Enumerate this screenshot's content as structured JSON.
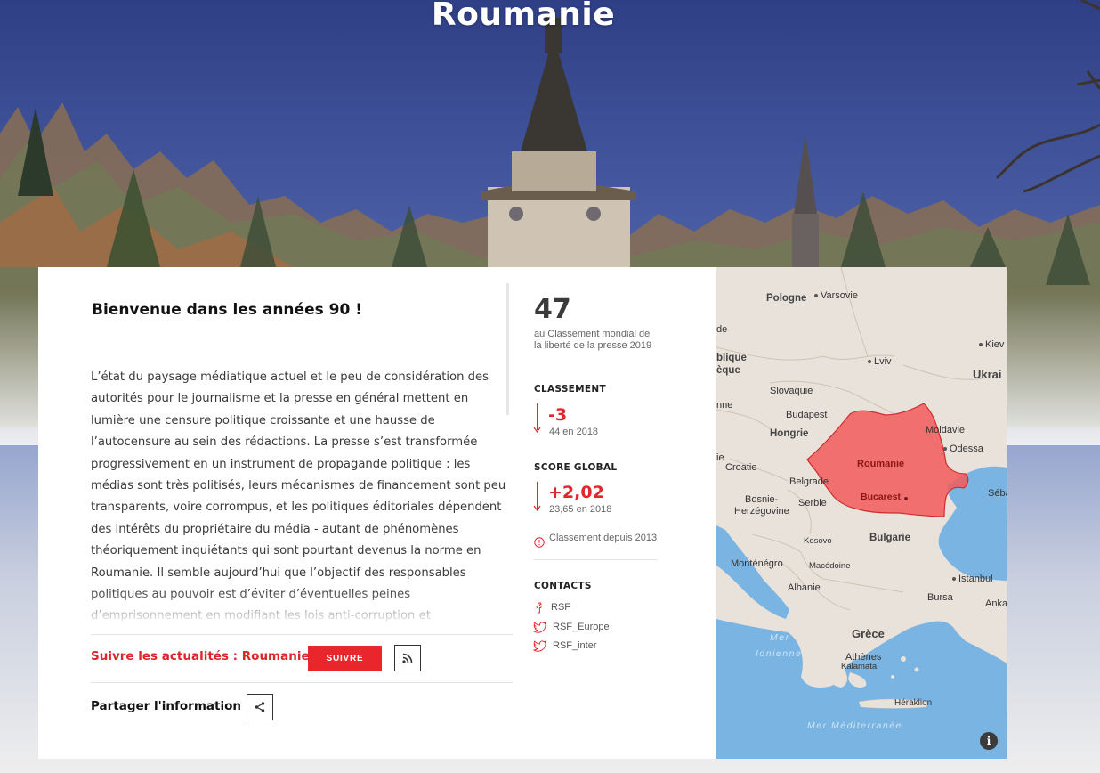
{
  "page": {
    "title": "Roumanie"
  },
  "article": {
    "title": "Bienvenue dans les années 90 !",
    "body": "L’état du paysage médiatique actuel et le peu de considération des autorités pour le journalisme et la presse en général mettent en lumière une censure politique croissante et une hausse de l’autocensure au sein des rédactions. La presse s’est transformée progressivement en un instrument de propagande politique : les médias sont très politisés, leurs mécanismes de financement sont peu transparents, voire corrompus, et les politiques éditoriales dépendent des intérêts du propriétaire du média - autant de phénomènes théoriquement inquiétants qui sont pourtant devenus la norme en Roumanie. Il semble aujourd’hui que l’objectif des responsables politiques au pouvoir est d’éviter d’éventuelles peines d’emprisonnement en modifiant les lois anti-corruption et"
  },
  "follow": {
    "label": "Suivre les actualités : Roumanie",
    "button": "SUIVRE",
    "rss_icon": "rss-icon"
  },
  "share": {
    "label": "Partager l'information",
    "icon": "share-icon"
  },
  "stats": {
    "rank": "47",
    "rank_caption": "au Classement mondial de la liberté de la presse 2019",
    "classement": {
      "title": "CLASSEMENT",
      "delta": "-3",
      "previous": "44 en 2018"
    },
    "score": {
      "title": "SCORE GLOBAL",
      "delta": "+2,02",
      "previous": "23,65 en 2018"
    },
    "since": "Classement depuis 2013",
    "since_icon": "info-circle-icon"
  },
  "contacts": {
    "title": "CONTACTS",
    "items": [
      {
        "icon": "facebook-icon",
        "label": "RSF"
      },
      {
        "icon": "twitter-icon",
        "label": "RSF_Europe"
      },
      {
        "icon": "twitter-icon",
        "label": "RSF_inter"
      }
    ]
  },
  "map": {
    "labels": {
      "pologne": "Pologne",
      "varsovie": "Varsovie",
      "lviv": "Lviv",
      "kiev": "Kiev",
      "ukraine": "Ukrai",
      "slovaquie": "Slovaquie",
      "budapest": "Budapest",
      "hongrie": "Hongrie",
      "moldavie": "Moldavie",
      "odessa": "Odessa",
      "roumanie": "Roumanie",
      "bucarest": "Bucarest",
      "croatie": "Croatie",
      "belgrade": "Belgrade",
      "serbie": "Serbie",
      "bosnie": "Bosnie-",
      "herzegovine": "Herzégovine",
      "kosovo": "Kosovo",
      "bulgarie": "Bulgarie",
      "montenegro": "Monténégro",
      "macedoine": "Macédoine",
      "albanie": "Albanie",
      "istanbul": "Istanbul",
      "bursa": "Bursa",
      "ankara": "Anka",
      "sebas": "Sébas",
      "grece": "Grèce",
      "athenes": "Athènes",
      "kalamata": "Kalamata",
      "heraklion": "Héraklion",
      "mer_ionienne_1": "Mer",
      "mer_ionienne_2": "Ionienne",
      "mer_med": "Mer Méditerranée",
      "de": "de",
      "blique": "blique",
      "eque": "èque",
      "nne": "nne",
      "ie": "ie"
    },
    "info_icon": "info-icon",
    "colors": {
      "romania": "#f25a5a",
      "sea": "#7ab4e2",
      "land": "#e9e2da"
    }
  }
}
